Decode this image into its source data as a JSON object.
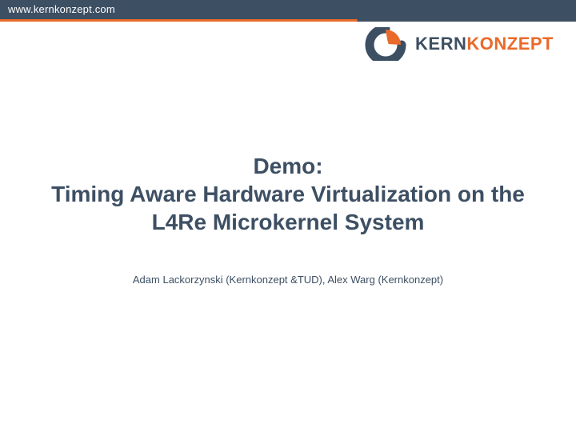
{
  "header": {
    "url": "www.kernkonzept.com"
  },
  "logo": {
    "kern": "KERN",
    "konzept": "KONZEPT"
  },
  "title": {
    "line1": "Demo:",
    "line2": "Timing Aware Hardware Virtualization on the",
    "line3": "L4Re Microkernel System"
  },
  "authors": "Adam Lackorzynski (Kernkonzept &TUD), Alex Warg (Kernkonzept)",
  "colors": {
    "brand_dark": "#3d4f63",
    "brand_orange": "#e96a2a"
  }
}
